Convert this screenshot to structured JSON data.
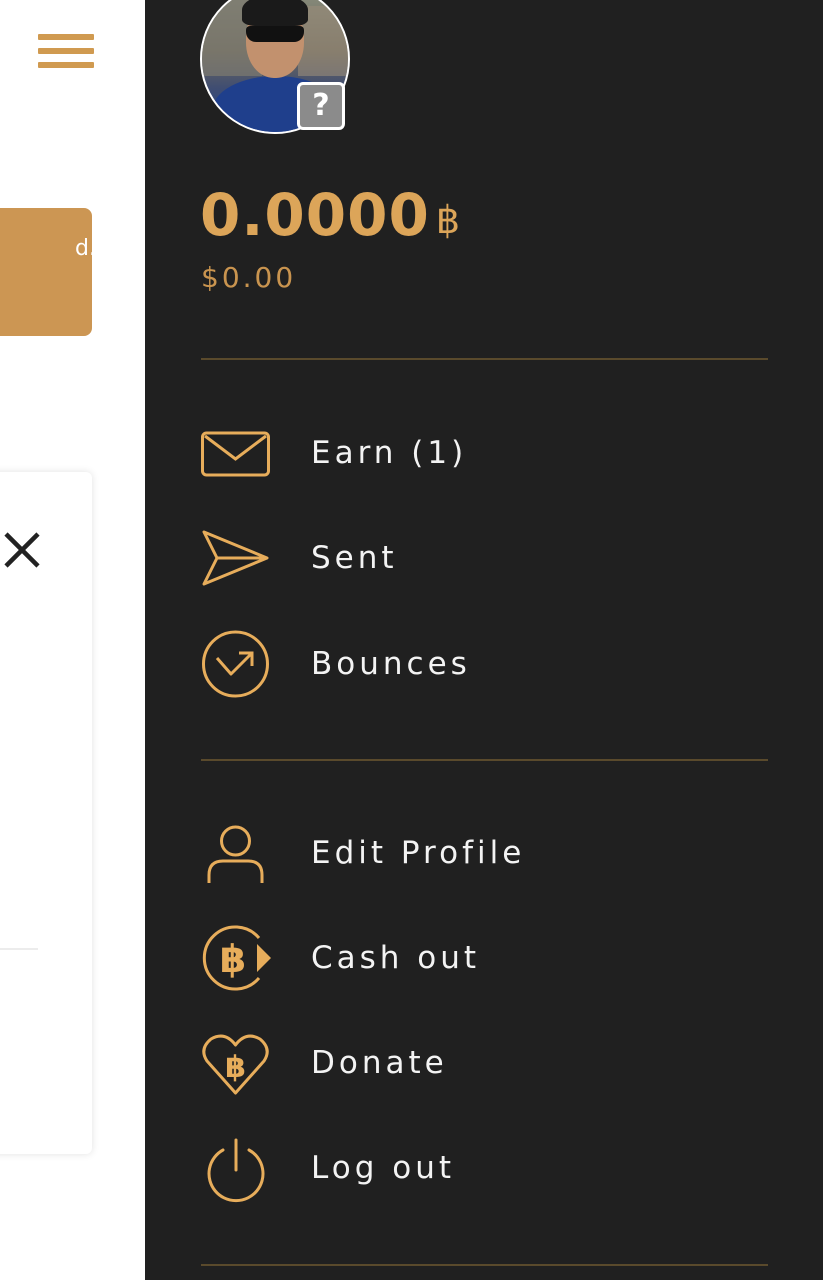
{
  "background_page": {
    "notice_text": "d."
  },
  "drawer": {
    "avatar_badge": "?",
    "balance": {
      "amount": "0.0000",
      "unit": "฿",
      "fiat": "$0.00"
    },
    "menu_primary": [
      {
        "label": "Earn (1)",
        "icon": "envelope-icon"
      },
      {
        "label": "Sent",
        "icon": "paper-plane-icon"
      },
      {
        "label": "Bounces",
        "icon": "bounce-arrow-icon"
      }
    ],
    "menu_secondary": [
      {
        "label": "Edit Profile",
        "icon": "user-icon"
      },
      {
        "label": "Cash out",
        "icon": "bitcoin-cashout-icon"
      },
      {
        "label": "Donate",
        "icon": "bitcoin-heart-icon"
      },
      {
        "label": "Log out",
        "icon": "power-icon"
      }
    ]
  },
  "colors": {
    "accent": "#dca559",
    "drawer_bg": "#202020",
    "notice_bg": "#cc9653"
  }
}
